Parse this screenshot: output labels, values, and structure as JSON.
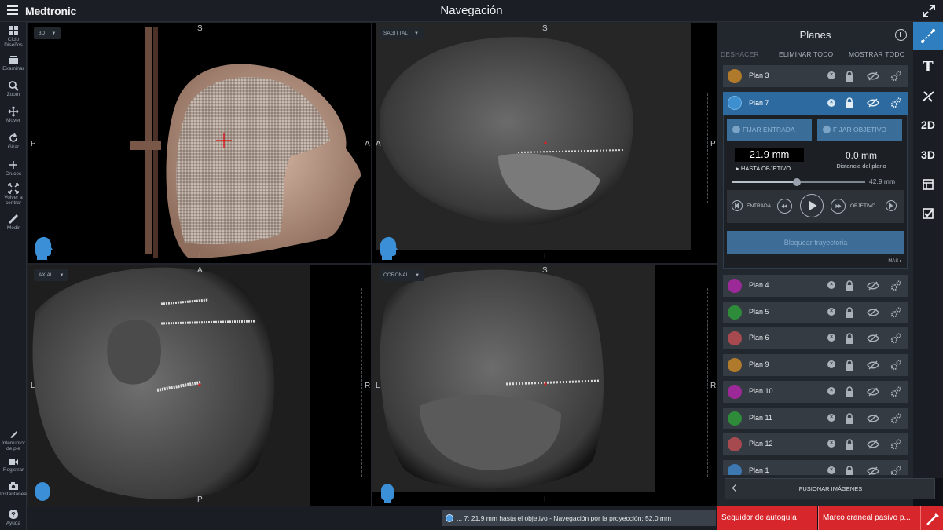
{
  "app": {
    "brand": "Medtronic",
    "title": "Navegación"
  },
  "left_toolbar": [
    {
      "label": "Ciclo Diseños",
      "icon": "layouts-icon"
    },
    {
      "label": "Examinar",
      "icon": "browse-icon"
    },
    {
      "label": "Zoom",
      "icon": "zoom-icon"
    },
    {
      "label": "Mover",
      "icon": "move-icon"
    },
    {
      "label": "Girar",
      "icon": "rotate-icon"
    },
    {
      "label": "Cruces",
      "icon": "crosshair-icon"
    },
    {
      "label": "Volver a centrar",
      "icon": "recenter-icon"
    },
    {
      "label": "Medir",
      "icon": "ruler-icon"
    }
  ],
  "left_toolbar_bottom": [
    {
      "label": "Interruptor de pie",
      "icon": "footswitch-icon"
    },
    {
      "label": "Registrar",
      "icon": "video-icon"
    },
    {
      "label": "Instantánea",
      "icon": "camera-icon"
    },
    {
      "label": "Ayuda",
      "icon": "help-icon"
    }
  ],
  "viewports": {
    "v3d": {
      "tag": "3D",
      "top": "S",
      "bottom": "I",
      "left": "P",
      "right": "A"
    },
    "sagittal": {
      "tag": "SAGITTAL",
      "top": "S",
      "bottom": "I",
      "left": "A",
      "right": "P"
    },
    "axial": {
      "tag": "AXIAL",
      "top": "A",
      "bottom": "P",
      "left": "L",
      "right": "R"
    },
    "coronal": {
      "tag": "CORONAL",
      "top": "S",
      "bottom": "I",
      "left": "L",
      "right": "R"
    }
  },
  "panel": {
    "title": "Planes",
    "actions": {
      "undo": "DESHACER",
      "delete_all": "ELIMINAR TODO",
      "show_all": "MOSTRAR TODO"
    },
    "plans_top": [
      {
        "name": "Plan 3",
        "color": "#b07a2c"
      }
    ],
    "active_plan": {
      "name": "Plan 7",
      "color": "#3d8fd0",
      "fix_entry": "FIJAR ENTRADA",
      "fix_target": "FIJAR OBJETIVO",
      "distance": "21.9 mm",
      "distance_label": "HASTA OBJETIVO",
      "plane_distance": "0.0 mm",
      "plane_distance_label": "Distancia del plano",
      "slider_max": "42.9 mm",
      "slider_fraction": 0.49,
      "entry_label": "ENTRADA",
      "target_label": "OBJETIVO",
      "lock_trajectory": "Bloquear trayectoria",
      "more": "MÁS ▸"
    },
    "plans_bottom": [
      {
        "name": "Plan 4",
        "color": "#9b2a98"
      },
      {
        "name": "Plan 5",
        "color": "#2e8b3a"
      },
      {
        "name": "Plan 6",
        "color": "#a64a50"
      },
      {
        "name": "Plan 9",
        "color": "#b07a2c"
      },
      {
        "name": "Plan 10",
        "color": "#9b2a98"
      },
      {
        "name": "Plan 11",
        "color": "#2e8b3a"
      },
      {
        "name": "Plan 12",
        "color": "#a64a50"
      },
      {
        "name": "Plan 1",
        "color": "#3d78b0"
      }
    ],
    "merge": "FUSIONAR IMÁGENES"
  },
  "right_toolbar": [
    {
      "label": "",
      "icon": "trajectory-icon",
      "active": true
    },
    {
      "label": "T",
      "icon": "text-icon"
    },
    {
      "label": "",
      "icon": "tool-icon"
    },
    {
      "label": "2D",
      "icon": "2d-icon"
    },
    {
      "label": "3D",
      "icon": "3d-icon"
    },
    {
      "label": "",
      "icon": "layout-icon"
    },
    {
      "label": "",
      "icon": "checklist-icon"
    }
  ],
  "status": {
    "navigation": "... 7: 21.9 mm hasta el objetivo - Navegación por la proyección: 52.0 mm",
    "alert_1": "Seguidor de autoguía",
    "alert_2": "Marco craneal pasivo p..."
  },
  "colors": {
    "accent": "#2e7ec0",
    "alert": "#d7262c"
  }
}
